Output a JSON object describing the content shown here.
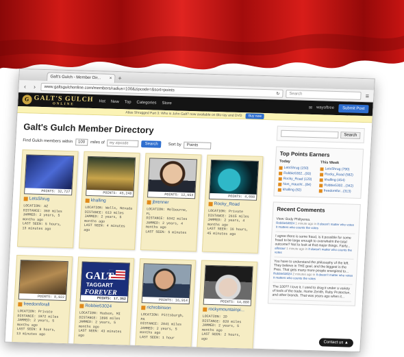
{
  "colors": {
    "curtain": "#c0110f",
    "nav_bg": "#141414",
    "accent": "#2f6fcf",
    "card_bg": "#f6edc4",
    "badge": "#e08a1b"
  },
  "browser": {
    "tab_title": "Galt's Gulch - Member Dir...",
    "url": "www.galtsgulchonline.com/members/radius=100&zipcode=&sort=points",
    "search_placeholder": "Search"
  },
  "site": {
    "logo_text": "GALT'S GULCH",
    "logo_sub": "ONLINE",
    "menu": [
      "Hot",
      "New",
      "Top",
      "Categories",
      "Store"
    ],
    "user": "wayoftree",
    "submit_label": "Submit Post"
  },
  "banner": {
    "text": "Atlas Shrugged Part 3: Who is John Galt? now available on Blu-ray and DVD",
    "button": "Buy now"
  },
  "page": {
    "title": "Galt's Gulch Member Directory",
    "find_label": "Find Gulch members within",
    "radius": "100",
    "miles_of": "miles of",
    "zip_placeholder": "my zipcode",
    "search_btn": "Search",
    "sort_label": "Sort by",
    "sort_value": "Points"
  },
  "members": [
    {
      "name": "LetsShrug",
      "points": "POINTS: 32,727",
      "lines": [
        "LOCATION: AZ",
        "DISTANCE: 360 miles",
        "JAMMED: 2 years, 5",
        "months ago",
        "LAST SEEN: 5 hours,",
        "13 minutes ago"
      ]
    },
    {
      "name": "khalling",
      "points": "POINTS: 43,248",
      "lines": [
        "LOCATION: Wells, Nevada",
        "DISTANCE: 613 miles",
        "JAMMED: 2 years, 5",
        "months ago",
        "LAST SEEN: 4 minutes",
        "ago"
      ]
    },
    {
      "name": "jbrenner",
      "points": "POINTS: 12,653",
      "lines": [
        "LOCATION: Melbourne,",
        "FL",
        "DISTANCE: 5342 miles",
        "JAMMED: 2 years, 4",
        "months ago",
        "LAST SEEN: 5 minutes",
        "ago"
      ]
    },
    {
      "name": "Rocky_Road",
      "points": "POINTS: 4,088",
      "lines": [
        "LOCATION: Private",
        "DISTANCE: 2615 miles",
        "JAMMED: 2 years, 4",
        "months ago",
        "LAST SEEN: 16 hours,",
        "45 minutes ago"
      ]
    },
    {
      "name": "freedomforall",
      "points": "POINTS: 8,922",
      "lines": [
        "LOCATION: Private",
        "DISTANCE: 1972 miles",
        "JAMMED: 2 years, 5",
        "months ago",
        "LAST SEEN: 8 hours,",
        "13 minutes ago"
      ]
    },
    {
      "name": "Robbie53024",
      "points": "POINTS: 17,352",
      "lines": [
        "LOCATION: Hudson, MI",
        "DISTANCE: 1896 miles",
        "JAMMED: 2 years, 5",
        "months ago",
        "LAST SEEN: 43 minutes",
        "ago"
      ]
    },
    {
      "name": "richrobinson",
      "points": "POINTS: 16,914",
      "lines": [
        "LOCATION: Pittsburgh,",
        "PA",
        "DISTANCE: 2041 miles",
        "JAMMED: 2 years, 5",
        "months ago",
        "LAST SEEN: 1 hour"
      ]
    },
    {
      "name": "rockymountainpi...",
      "points": "POINTS: 14,880",
      "lines": [
        "LOCATION: ID",
        "DISTANCE: 820 miles",
        "JAMMED: 2 years, 5",
        "months ago",
        "LAST SEEN: 2 hours,",
        "ago"
      ]
    }
  ],
  "sidebar": {
    "search_btn": "Search",
    "earners_title": "Top Points Earners",
    "today_label": "Today",
    "week_label": "This Week",
    "today": [
      "LetsShrug (150)",
      "Robbie5302...(93)",
      "Rocky_Road (120)",
      "Non_mauchl...(84)",
      "khalling (82)"
    ],
    "week": [
      "LetsShrug (790)",
      "Rocky_Road (582)",
      "khalling (454)",
      "Robbie5302...(342)",
      "freedomfor...(313)"
    ],
    "comments_title": "Recent Comments",
    "comments": [
      {
        "text": "View: Body Philtyerea.",
        "user": "Robbie53024",
        "meta": "1 minute ago in",
        "post": "It doesn't matter who votes it matters who counts the votes"
      },
      {
        "text": "I agree there is some fraud, is it possible for some fraud to be large enough to overwhelm the total outcome? Not to look at that major things. Fairly...",
        "user": "allosaur",
        "meta": "1 minute ago in",
        "post": "It doesn't matter who counts the votes"
      },
      {
        "text": "You have to understand the philosophy of the left. They believe in THE goal, and the biggest is the Pres. That gets many more people energized to...",
        "user": "Robbie53024",
        "meta": "2 minutes ago in",
        "post": "It doesn't matter who votes it matters who counts the votes"
      },
      {
        "text": "The 100?? I love it. I used to drag it under a variety of tools of the trade. Home Zenith, Ruby Protection, and other brands. That was years ago when it...",
        "user": "",
        "meta": "",
        "post": ""
      }
    ],
    "contact": "Contact us"
  }
}
